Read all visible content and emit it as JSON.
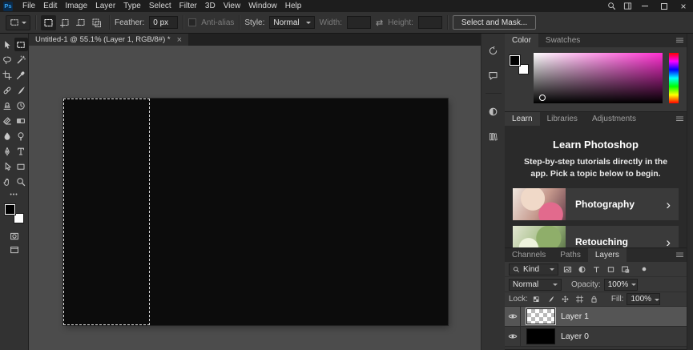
{
  "titlebar": {
    "app_icon": "Ps",
    "menus": [
      "File",
      "Edit",
      "Image",
      "Layer",
      "Type",
      "Select",
      "Filter",
      "3D",
      "View",
      "Window",
      "Help"
    ],
    "close_glyph": "×"
  },
  "options_bar": {
    "feather_label": "Feather:",
    "feather_value": "0 px",
    "anti_alias_label": "Anti-alias",
    "style_label": "Style:",
    "style_value": "Normal",
    "width_label": "Width:",
    "width_value": "",
    "swap_glyph": "⇄",
    "height_label": "Height:",
    "height_value": "",
    "select_and_mask_label": "Select and Mask...",
    "mode_buttons": [
      "new-selection",
      "add-to-selection",
      "subtract-from-selection",
      "intersect-selection"
    ]
  },
  "document": {
    "tab_title": "Untitled-1 @ 55.1% (Layer 1, RGB/8#) *",
    "tab_close_glyph": "×"
  },
  "toolbar": {
    "tools": [
      "move",
      "rectangular-marquee",
      "lasso",
      "quick-selection",
      "crop",
      "eyedropper",
      "spot-healing-brush",
      "brush",
      "clone-stamp",
      "history-brush",
      "eraser",
      "gradient",
      "blur",
      "dodge",
      "pen",
      "type",
      "path-selection",
      "rectangle-shape",
      "hand",
      "zoom"
    ],
    "selected_tool": "rectangular-marquee",
    "edit_toolbar_glyph": "•••",
    "foreground_color": "#000000",
    "background_color": "#ffffff"
  },
  "collapsed_panels": [
    "history-icon",
    "comments-icon",
    "adjustments-icon",
    "libraries-icon"
  ],
  "color_panel": {
    "tabs": [
      "Color",
      "Swatches"
    ],
    "active_tab": "Color",
    "hue_color": "#ff2fd1"
  },
  "learn_panel": {
    "tabs": [
      "Learn",
      "Libraries",
      "Adjustments"
    ],
    "active_tab": "Learn",
    "title": "Learn Photoshop",
    "subtitle": "Step-by-step tutorials directly in the app. Pick a topic below to begin.",
    "topics": [
      {
        "label": "Photography"
      },
      {
        "label": "Retouching"
      }
    ],
    "chevron_glyph": "›"
  },
  "layers_panel": {
    "tabs": [
      "Channels",
      "Paths",
      "Layers"
    ],
    "active_tab": "Layers",
    "filter_kind_label": "Kind",
    "filter_icons": [
      "pixel-layer-filter",
      "adjustment-layer-filter",
      "type-layer-filter",
      "shape-layer-filter",
      "smart-object-filter"
    ],
    "blend_mode": "Normal",
    "opacity_label": "Opacity:",
    "opacity_value": "100%",
    "lock_label": "Lock:",
    "lock_icons": [
      "lock-transparent",
      "lock-paint",
      "lock-position",
      "lock-artboard",
      "lock-all"
    ],
    "fill_label": "Fill:",
    "fill_value": "100%",
    "layers": [
      {
        "name": "Layer 1",
        "selected": true,
        "thumbnail": "transparent-checkerboard",
        "visible": true
      },
      {
        "name": "Layer 0",
        "selected": false,
        "thumbnail": "solid-black",
        "visible": true
      }
    ]
  },
  "canvas": {
    "pasteboard_color": "#4c4c4c",
    "document_color": "#0c0c0c",
    "selection_dash_color": "#dedede"
  }
}
